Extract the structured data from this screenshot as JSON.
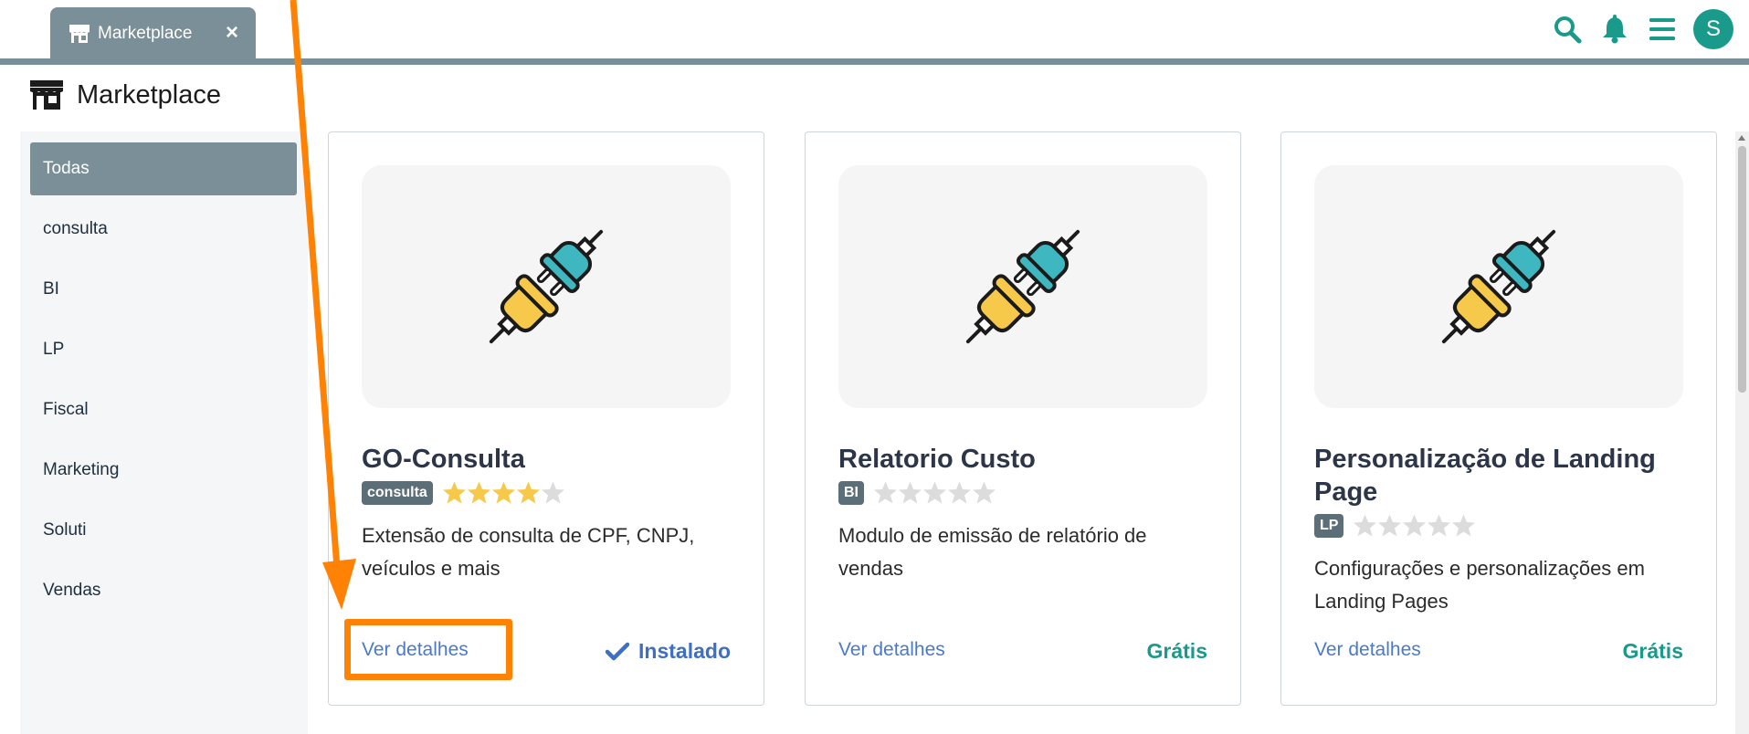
{
  "tab": {
    "label": "Marketplace",
    "close_icon": "close-icon"
  },
  "header_icons": [
    "search-icon",
    "bell-icon",
    "menu-icon"
  ],
  "user": {
    "avatar_initial": "S"
  },
  "page": {
    "title": "Marketplace"
  },
  "sidebar": {
    "items": [
      {
        "label": "Todas",
        "active": true
      },
      {
        "label": "consulta"
      },
      {
        "label": "BI"
      },
      {
        "label": "LP"
      },
      {
        "label": "Fiscal"
      },
      {
        "label": "Marketing"
      },
      {
        "label": "Soluti"
      },
      {
        "label": "Vendas"
      }
    ]
  },
  "cards": [
    {
      "title": "GO-Consulta",
      "badge": "consulta",
      "rating": 4,
      "description": "Extensão de consulta de CPF, CNPJ, veículos e mais",
      "details_label": "Ver detalhes",
      "status_label": "Instalado",
      "status_type": "installed"
    },
    {
      "title": "Relatorio Custo",
      "badge": "BI",
      "rating": 0,
      "description": "Modulo de emissão de relatório de vendas",
      "details_label": "Ver detalhes",
      "status_label": "Grátis",
      "status_type": "free"
    },
    {
      "title": "Personalização de Landing Page",
      "badge": "LP",
      "rating": 0,
      "description": "Configurações e personalizações em Landing Pages",
      "details_label": "Ver detalhes",
      "status_label": "Grátis",
      "status_type": "free"
    }
  ],
  "colors": {
    "accent": "#1a9a8a",
    "tab_bg": "#7a8f98",
    "link": "#4a7ac9",
    "annotation": "#ff8205",
    "star_filled": "#f7c94b",
    "star_empty": "#dcdcdc"
  }
}
